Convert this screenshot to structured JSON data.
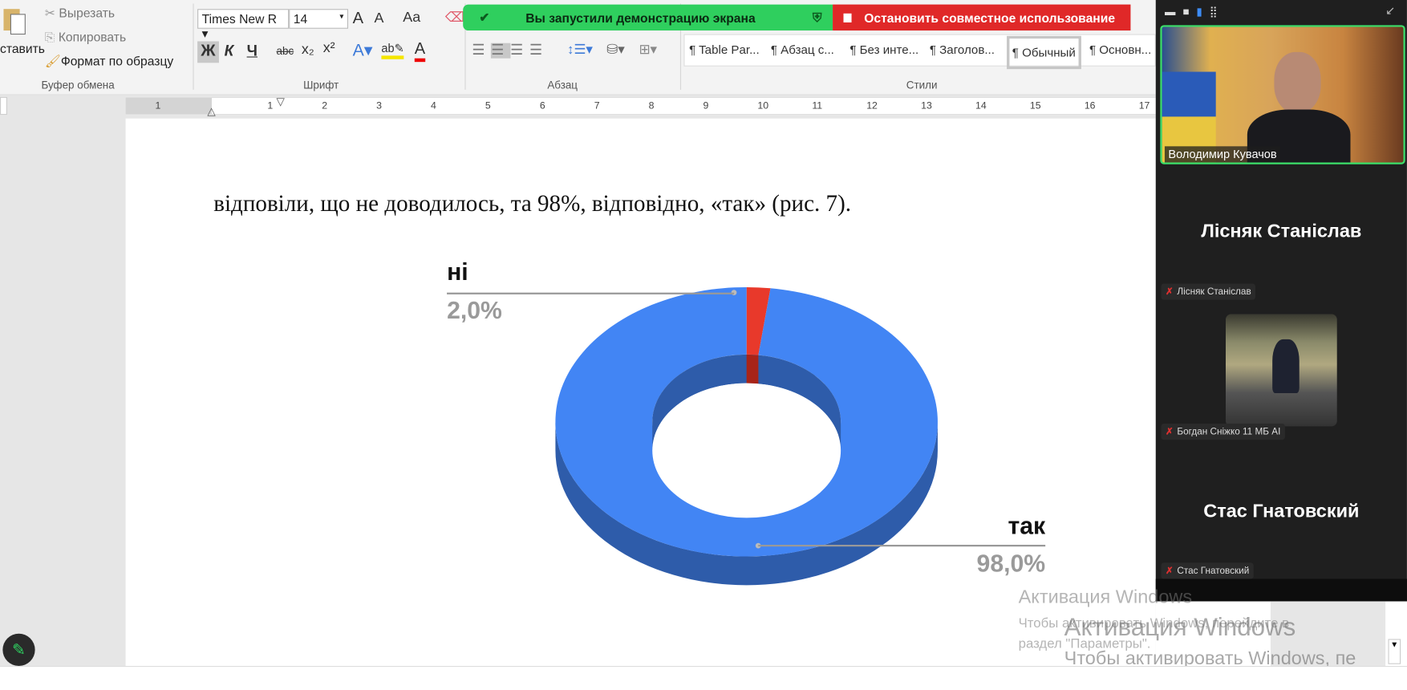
{
  "ribbon": {
    "clipboard": {
      "paste": "ставить",
      "cut": "Вырезать",
      "copy": "Копировать",
      "format_painter": "Формат по образцу",
      "group": "Буфер обмена"
    },
    "font": {
      "name": "Times New R",
      "size": "14",
      "grow": "A",
      "shrink": "A",
      "case": "Aa",
      "bold": "Ж",
      "italic": "К",
      "underline": "Ч",
      "strike": "abc",
      "sub": "x₂",
      "sup": "x²",
      "group": "Шрифт"
    },
    "paragraph": {
      "group": "Абзац"
    },
    "styles": {
      "items": [
        "¶ Table Par...",
        "¶ Абзац с...",
        "¶ Без инте...",
        "¶ Заголов...",
        "¶ Обычный",
        "¶ Основн..."
      ],
      "group": "Стили"
    }
  },
  "share": {
    "status": "Вы запустили демонстрацию экрана",
    "stop": "Остановить совместное использование"
  },
  "ruler": {
    "ticks": [
      "1",
      "1",
      "2",
      "3",
      "4",
      "5",
      "6",
      "7",
      "8",
      "9",
      "10",
      "11",
      "12",
      "13",
      "14",
      "15",
      "16",
      "17"
    ]
  },
  "document": {
    "text": "відповіли, що не доводилось, та 98%, відповідно, «так» (рис. 7)."
  },
  "chart_data": {
    "type": "pie",
    "style": "3d-donut",
    "categories": [
      "ні",
      "так"
    ],
    "values": [
      2.0,
      98.0
    ],
    "labels": [
      "2,0%",
      "98,0%"
    ],
    "colors": [
      "#e8392b",
      "#4285f4"
    ]
  },
  "zoom": {
    "speaker": "Володимир Кувачов",
    "participants": [
      {
        "big": "Лісняк Станіслав",
        "tag": "Лісняк Станіслав"
      },
      {
        "tag": "Богдан Сніжко  11 МБ АІ"
      },
      {
        "big": "Стас Гнатовский",
        "tag": "Стас Гнатовский"
      }
    ]
  },
  "watermark": {
    "title": "Активация Windows",
    "line1": "Чтобы активировать Windows, перейдите в",
    "line2": "раздел \"Параметры\".",
    "title2": "Активация Windows",
    "line3": "Чтобы активировать Windows, пе"
  }
}
